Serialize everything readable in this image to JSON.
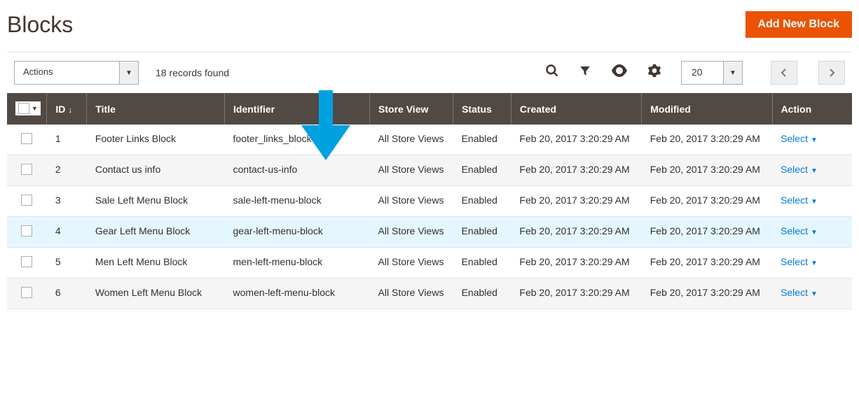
{
  "page_title": "Blocks",
  "add_button": "Add New Block",
  "actions_label": "Actions",
  "records_found": "18 records found",
  "per_page": "20",
  "columns": {
    "id": "ID",
    "title": "Title",
    "identifier": "Identifier",
    "store_view": "Store View",
    "status": "Status",
    "created": "Created",
    "modified": "Modified",
    "action": "Action"
  },
  "select_label": "Select",
  "rows": [
    {
      "id": "1",
      "title": "Footer Links Block",
      "identifier": "footer_links_block",
      "store_view": "All Store Views",
      "status": "Enabled",
      "created": "Feb 20, 2017 3:20:29 AM",
      "modified": "Feb 20, 2017 3:20:29 AM"
    },
    {
      "id": "2",
      "title": "Contact us info",
      "identifier": "contact-us-info",
      "store_view": "All Store Views",
      "status": "Enabled",
      "created": "Feb 20, 2017 3:20:29 AM",
      "modified": "Feb 20, 2017 3:20:29 AM"
    },
    {
      "id": "3",
      "title": "Sale Left Menu Block",
      "identifier": "sale-left-menu-block",
      "store_view": "All Store Views",
      "status": "Enabled",
      "created": "Feb 20, 2017 3:20:29 AM",
      "modified": "Feb 20, 2017 3:20:29 AM"
    },
    {
      "id": "4",
      "title": "Gear Left Menu Block",
      "identifier": "gear-left-menu-block",
      "store_view": "All Store Views",
      "status": "Enabled",
      "created": "Feb 20, 2017 3:20:29 AM",
      "modified": "Feb 20, 2017 3:20:29 AM",
      "highlight": true
    },
    {
      "id": "5",
      "title": "Men Left Menu Block",
      "identifier": "men-left-menu-block",
      "store_view": "All Store Views",
      "status": "Enabled",
      "created": "Feb 20, 2017 3:20:29 AM",
      "modified": "Feb 20, 2017 3:20:29 AM"
    },
    {
      "id": "6",
      "title": "Women Left Menu Block",
      "identifier": "women-left-menu-block",
      "store_view": "All Store Views",
      "status": "Enabled",
      "created": "Feb 20, 2017 3:20:29 AM",
      "modified": "Feb 20, 2017 3:20:29 AM"
    }
  ]
}
